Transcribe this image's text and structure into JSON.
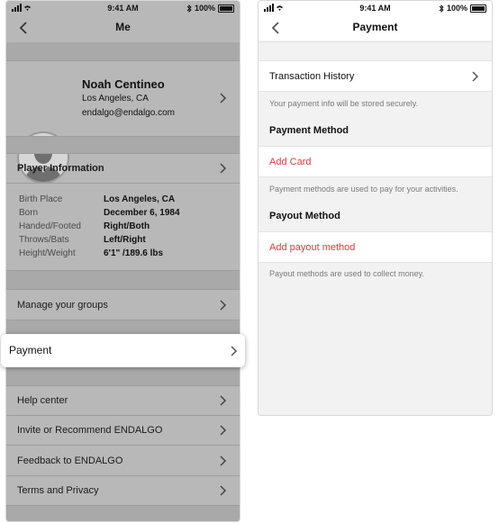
{
  "left_screen": {
    "status": {
      "time": "9:41 AM",
      "battery": "100%"
    },
    "title": "Me",
    "profile": {
      "name": "Noah Centineo",
      "city": "Los Angeles, CA",
      "email": "endalgo@endalgo.com"
    },
    "player_info": {
      "title": "Player Information",
      "rows": [
        {
          "key": "Birth Place",
          "value": "Los Angeles, CA"
        },
        {
          "key": "Born",
          "value": "December 6, 1984"
        },
        {
          "key": "Handed/Footed",
          "value": "Right/Both"
        },
        {
          "key": "Throws/Bats",
          "value": "Left/Right"
        },
        {
          "key": "Height/Weight",
          "value": "6'1\" /189.6 lbs"
        }
      ]
    },
    "menu": {
      "manage_groups": "Manage your groups",
      "payment": "Payment",
      "help_center": "Help center",
      "invite": "Invite or Recommend ENDALGO",
      "feedback": "Feedback to ENDALGO",
      "terms": "Terms and Privacy"
    }
  },
  "right_screen": {
    "status": {
      "time": "9:41 AM",
      "battery": "100%"
    },
    "title": "Payment",
    "transaction_history": "Transaction History",
    "secure_note": "Your payment info will be stored securely.",
    "payment_method": {
      "title": "Payment Method",
      "add_label": "Add Card",
      "note": "Payment methods are used to pay for your activities."
    },
    "payout_method": {
      "title": "Payout Method",
      "add_label": "Add payout method",
      "note": "Payout methods are used to collect money."
    }
  },
  "colors": {
    "accent_red": "#e8373f",
    "dimmed_background": "#b8b8b8",
    "light_background": "#f2f2f2"
  },
  "icons": [
    "signal-icon",
    "wifi-icon",
    "bluetooth-icon",
    "battery-icon",
    "back-chevron-icon",
    "chevron-right-icon",
    "avatar-silhouette-icon"
  ]
}
